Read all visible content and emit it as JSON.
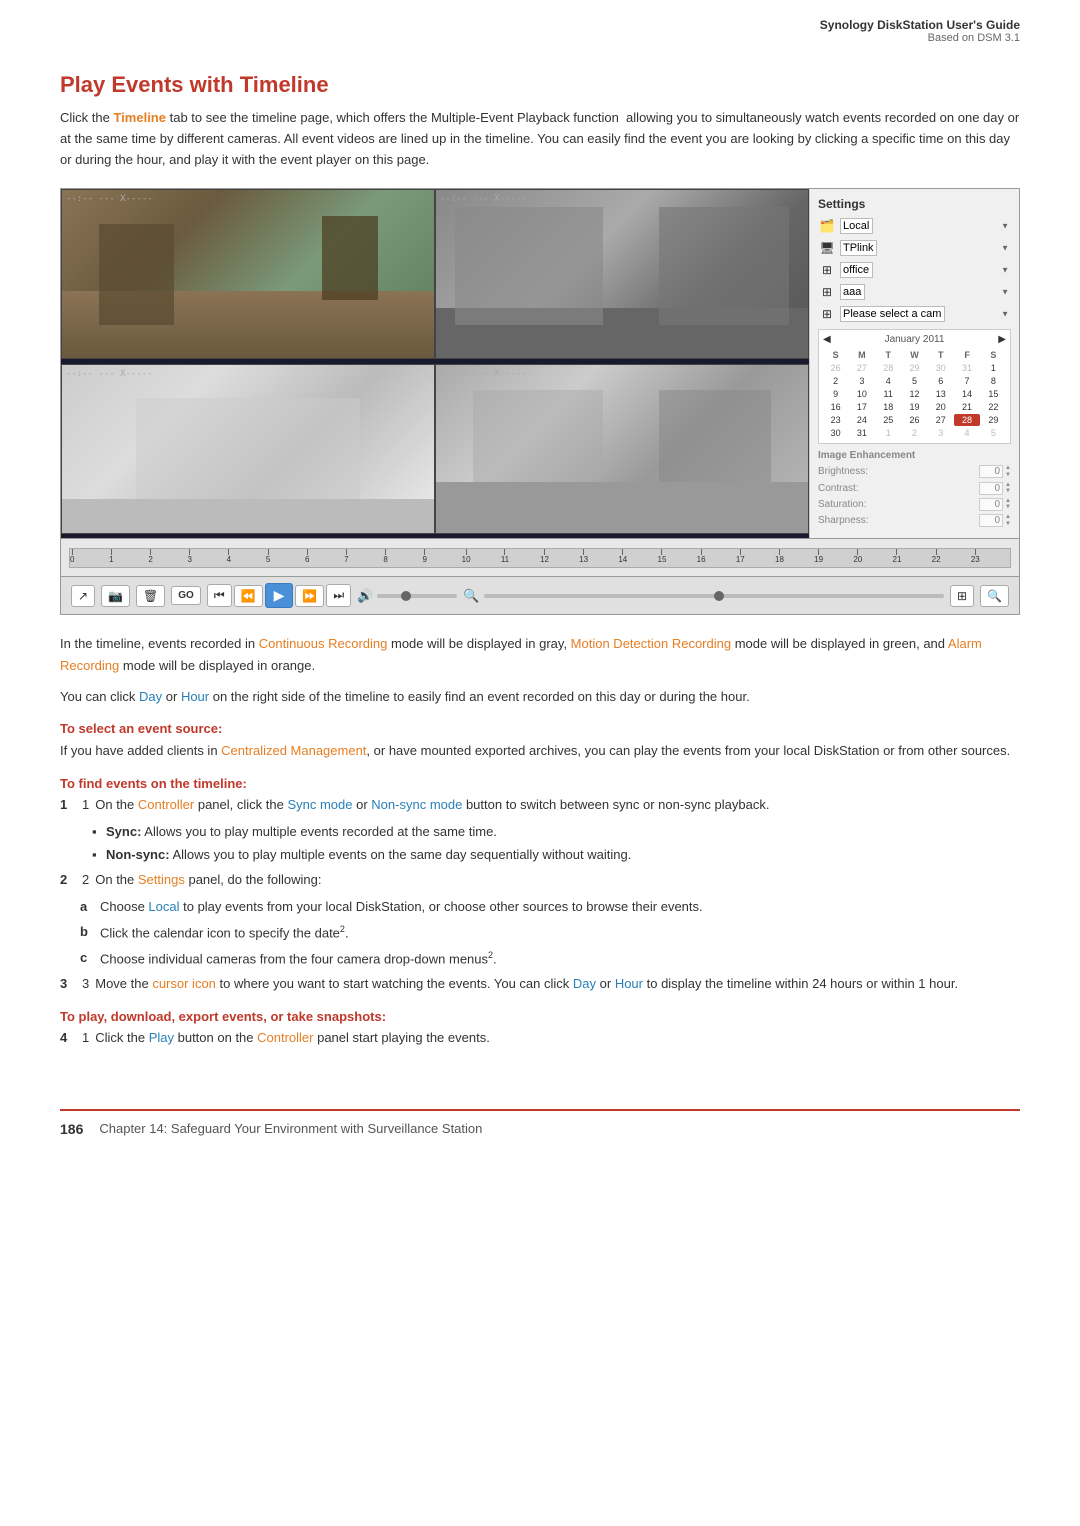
{
  "header": {
    "title": "Synology DiskStation User's Guide",
    "subtitle": "Based on DSM 3.1"
  },
  "section": {
    "title": "Play Events with Timeline",
    "intro": "Click the Timeline tab to see the timeline page, which offers the Multiple-Event Playback function  allowing you to simultaneously watch events recorded on one day or at the same time by different cameras. All event videos are lined up in the timeline. You can easily find the event you are looking by clicking a specific time on this day or during the hour, and play it with the event player on this page."
  },
  "settings_panel": {
    "title": "Settings",
    "rows": [
      {
        "icon": "📁",
        "value": "Local"
      },
      {
        "icon": "🖥",
        "value": "TPlink"
      },
      {
        "icon": "🔲",
        "value": "office"
      },
      {
        "icon": "🔲",
        "value": "aaa"
      },
      {
        "icon": "🔲",
        "value": "Please select a cam"
      }
    ]
  },
  "calendar": {
    "month": "January 2011",
    "days_header": [
      "S",
      "M",
      "T",
      "W",
      "T",
      "F",
      "S"
    ],
    "weeks": [
      [
        "26",
        "27",
        "28",
        "29",
        "30",
        "31",
        "1"
      ],
      [
        "2",
        "3",
        "4",
        "5",
        "6",
        "7",
        "8"
      ],
      [
        "9",
        "10",
        "11",
        "12",
        "13",
        "14",
        "15"
      ],
      [
        "16",
        "17",
        "18",
        "19",
        "20",
        "21",
        "22"
      ],
      [
        "23",
        "24",
        "25",
        "26",
        "27",
        "28",
        "29"
      ],
      [
        "30",
        "31",
        "1",
        "2",
        "3",
        "4",
        "5"
      ]
    ],
    "today_index": "28",
    "other_month_start": [
      "26",
      "27",
      "28",
      "29",
      "30",
      "31"
    ],
    "other_month_end": [
      "1",
      "2",
      "3",
      "4",
      "5"
    ]
  },
  "image_enhancement": {
    "title": "Image Enhancement",
    "fields": [
      {
        "label": "Brightness:",
        "value": "0"
      },
      {
        "label": "Contrast:",
        "value": "0"
      },
      {
        "label": "Saturation:",
        "value": "0"
      },
      {
        "label": "Sharpness:",
        "value": "0"
      }
    ]
  },
  "timeline": {
    "ticks": [
      "0",
      "1",
      "2",
      "3",
      "4",
      "5",
      "6",
      "7",
      "8",
      "9",
      "10",
      "11",
      "12",
      "13",
      "14",
      "15",
      "16",
      "17",
      "18",
      "19",
      "20",
      "21",
      "22",
      "23"
    ]
  },
  "body": {
    "para1_parts": [
      {
        "text": "In the timeline, events recorded in ",
        "type": "normal"
      },
      {
        "text": "Continuous Recording",
        "type": "orange"
      },
      {
        "text": " mode will be displayed in gray, ",
        "type": "normal"
      },
      {
        "text": "Motion Detection Recording",
        "type": "orange"
      },
      {
        "text": " mode will be displayed in green, and ",
        "type": "normal"
      },
      {
        "text": "Alarm Recording",
        "type": "orange"
      },
      {
        "text": " mode will be displayed in orange.",
        "type": "normal"
      }
    ],
    "para2": "You can click Day or Hour on the right side of the timeline to easily find an event recorded on this day or during the hour.",
    "para2_parts": [
      {
        "text": "You can click ",
        "type": "normal"
      },
      {
        "text": "Day",
        "type": "blue"
      },
      {
        "text": " or ",
        "type": "normal"
      },
      {
        "text": "Hour",
        "type": "blue"
      },
      {
        "text": " on the right side of the timeline to easily find an event recorded on this day or during the hour.",
        "type": "normal"
      }
    ],
    "subheading1": "To select an event source:",
    "subheading1_text_parts": [
      {
        "text": "If you have added clients in ",
        "type": "normal"
      },
      {
        "text": "Centralized Management",
        "type": "orange"
      },
      {
        "text": ", or have mounted exported archives, you can play the events from your local DiskStation or from other sources.",
        "type": "normal"
      }
    ],
    "subheading2": "To find events on the timeline:",
    "steps": [
      {
        "num": "1",
        "parts": [
          {
            "text": "On the ",
            "type": "normal"
          },
          {
            "text": "Controller",
            "type": "orange"
          },
          {
            "text": " panel, click the ",
            "type": "normal"
          },
          {
            "text": "Sync mode",
            "type": "blue"
          },
          {
            "text": " or ",
            "type": "normal"
          },
          {
            "text": "Non-sync mode",
            "type": "blue"
          },
          {
            "text": " button to switch between sync or non-sync playback.",
            "type": "normal"
          }
        ],
        "bullets": [
          {
            "parts": [
              {
                "text": "Sync:",
                "type": "bold"
              },
              {
                "text": " Allows you to play multiple events recorded at the same time.",
                "type": "normal"
              }
            ]
          },
          {
            "parts": [
              {
                "text": "Non-sync:",
                "type": "bold"
              },
              {
                "text": " Allows you to play multiple events on the same day sequentially without waiting.",
                "type": "normal"
              }
            ]
          }
        ]
      },
      {
        "num": "2",
        "parts": [
          {
            "text": "On the ",
            "type": "normal"
          },
          {
            "text": "Settings",
            "type": "orange"
          },
          {
            "text": " panel, do the following:",
            "type": "normal"
          }
        ],
        "alpha": [
          {
            "label": "a",
            "parts": [
              {
                "text": "Choose ",
                "type": "normal"
              },
              {
                "text": "Local",
                "type": "blue"
              },
              {
                "text": " to play events from your local DiskStation, or choose other sources to browse their events.",
                "type": "normal"
              }
            ]
          },
          {
            "label": "b",
            "parts": [
              {
                "text": "Click the calendar icon to specify the date",
                "type": "normal"
              },
              {
                "text": "2",
                "type": "sup"
              },
              {
                "text": ".",
                "type": "normal"
              }
            ]
          },
          {
            "label": "c",
            "parts": [
              {
                "text": "Choose individual cameras from the four camera drop-down menus",
                "type": "normal"
              },
              {
                "text": "2",
                "type": "sup"
              },
              {
                "text": ".",
                "type": "normal"
              }
            ]
          }
        ]
      },
      {
        "num": "3",
        "parts": [
          {
            "text": "Move the ",
            "type": "normal"
          },
          {
            "text": "cursor icon",
            "type": "orange"
          },
          {
            "text": " to where you want to start watching the events. You can click ",
            "type": "normal"
          },
          {
            "text": "Day",
            "type": "blue"
          },
          {
            "text": " or ",
            "type": "normal"
          },
          {
            "text": "Hour",
            "type": "blue"
          },
          {
            "text": " to display the timeline within 24 hours or within 1 hour.",
            "type": "normal"
          }
        ]
      }
    ],
    "subheading3": "To play, download, export events, or take snapshots:",
    "steps2": [
      {
        "num": "1",
        "parts": [
          {
            "text": "Click the ",
            "type": "normal"
          },
          {
            "text": "Play",
            "type": "blue"
          },
          {
            "text": " button on the ",
            "type": "normal"
          },
          {
            "text": "Controller",
            "type": "orange"
          },
          {
            "text": " panel start playing the events.",
            "type": "normal"
          }
        ]
      }
    ]
  },
  "footer": {
    "page": "186",
    "chapter": "Chapter 14: Safeguard Your Environment with Surveillance Station"
  }
}
